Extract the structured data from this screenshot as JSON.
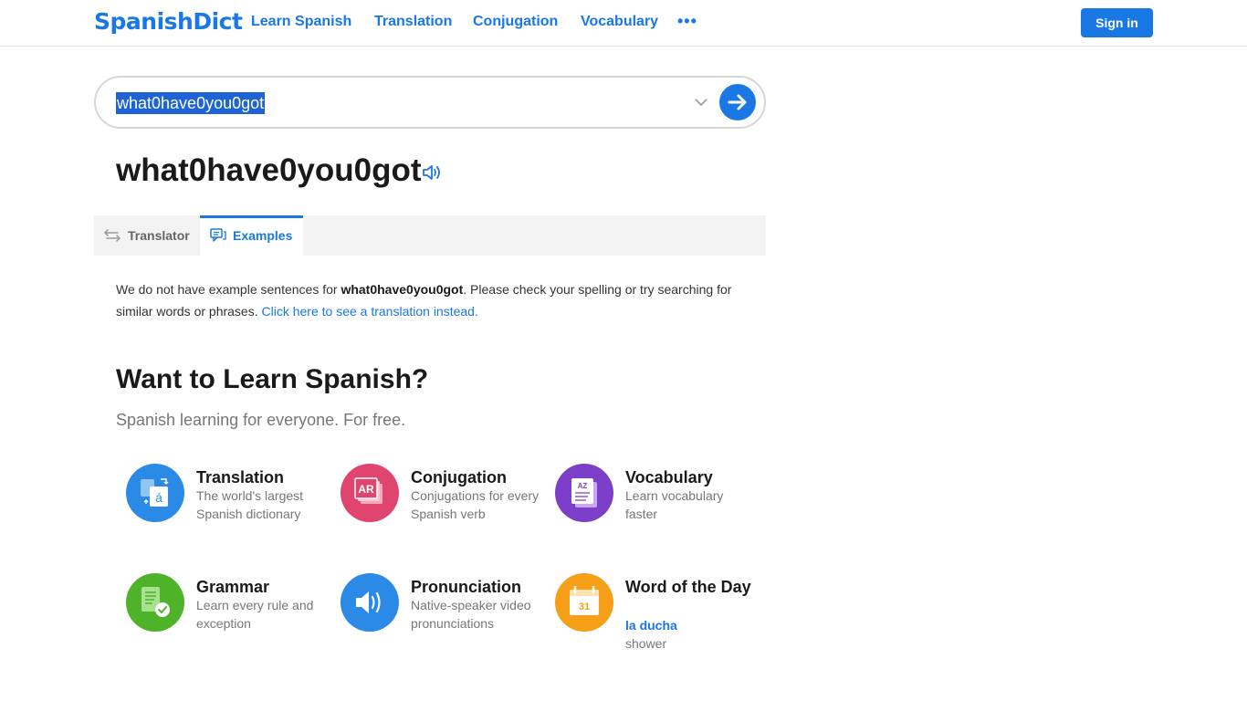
{
  "header": {
    "logo": "SpanishDict",
    "nav": [
      "Learn Spanish",
      "Translation",
      "Conjugation",
      "Vocabulary"
    ],
    "more": "•••",
    "signin": "Sign in"
  },
  "search": {
    "value": "what0have0you0got"
  },
  "word": {
    "title": "what0have0you0got"
  },
  "tabs": [
    {
      "label": "Translator",
      "active": false
    },
    {
      "label": "Examples",
      "active": true
    }
  ],
  "message": {
    "prefix": "We do not have example sentences for ",
    "term": "what0have0you0got",
    "suffix": ". Please check your spelling or try searching for similar words or phrases. ",
    "link": "Click here to see a translation instead."
  },
  "learn": {
    "title": "Want to Learn Spanish?",
    "subtitle": "Spanish learning for everyone. For free.",
    "cards": [
      {
        "title": "Translation",
        "desc": "The world's largest Spanish dictionary",
        "icon": "translation-icon",
        "color": "#2a8ae6"
      },
      {
        "title": "Conjugation",
        "desc": "Conjugations for every Spanish verb",
        "icon": "conjugation-icon",
        "color": "#e0456f"
      },
      {
        "title": "Vocabulary",
        "desc": "Learn vocabulary faster",
        "icon": "vocabulary-icon",
        "color": "#7b3fc9"
      },
      {
        "title": "Grammar",
        "desc": "Learn every rule and exception",
        "icon": "grammar-icon",
        "color": "#4fb32a"
      },
      {
        "title": "Pronunciation",
        "desc": "Native-speaker video pronunciations",
        "icon": "pronunciation-icon",
        "color": "#2a8ae6"
      },
      {
        "title": "Word of the Day",
        "word": "la ducha",
        "meaning": "shower",
        "icon": "calendar-icon",
        "icon_text": "31",
        "color": "#f6a01a"
      }
    ]
  },
  "colors": {
    "brand": "#1a78e5"
  }
}
